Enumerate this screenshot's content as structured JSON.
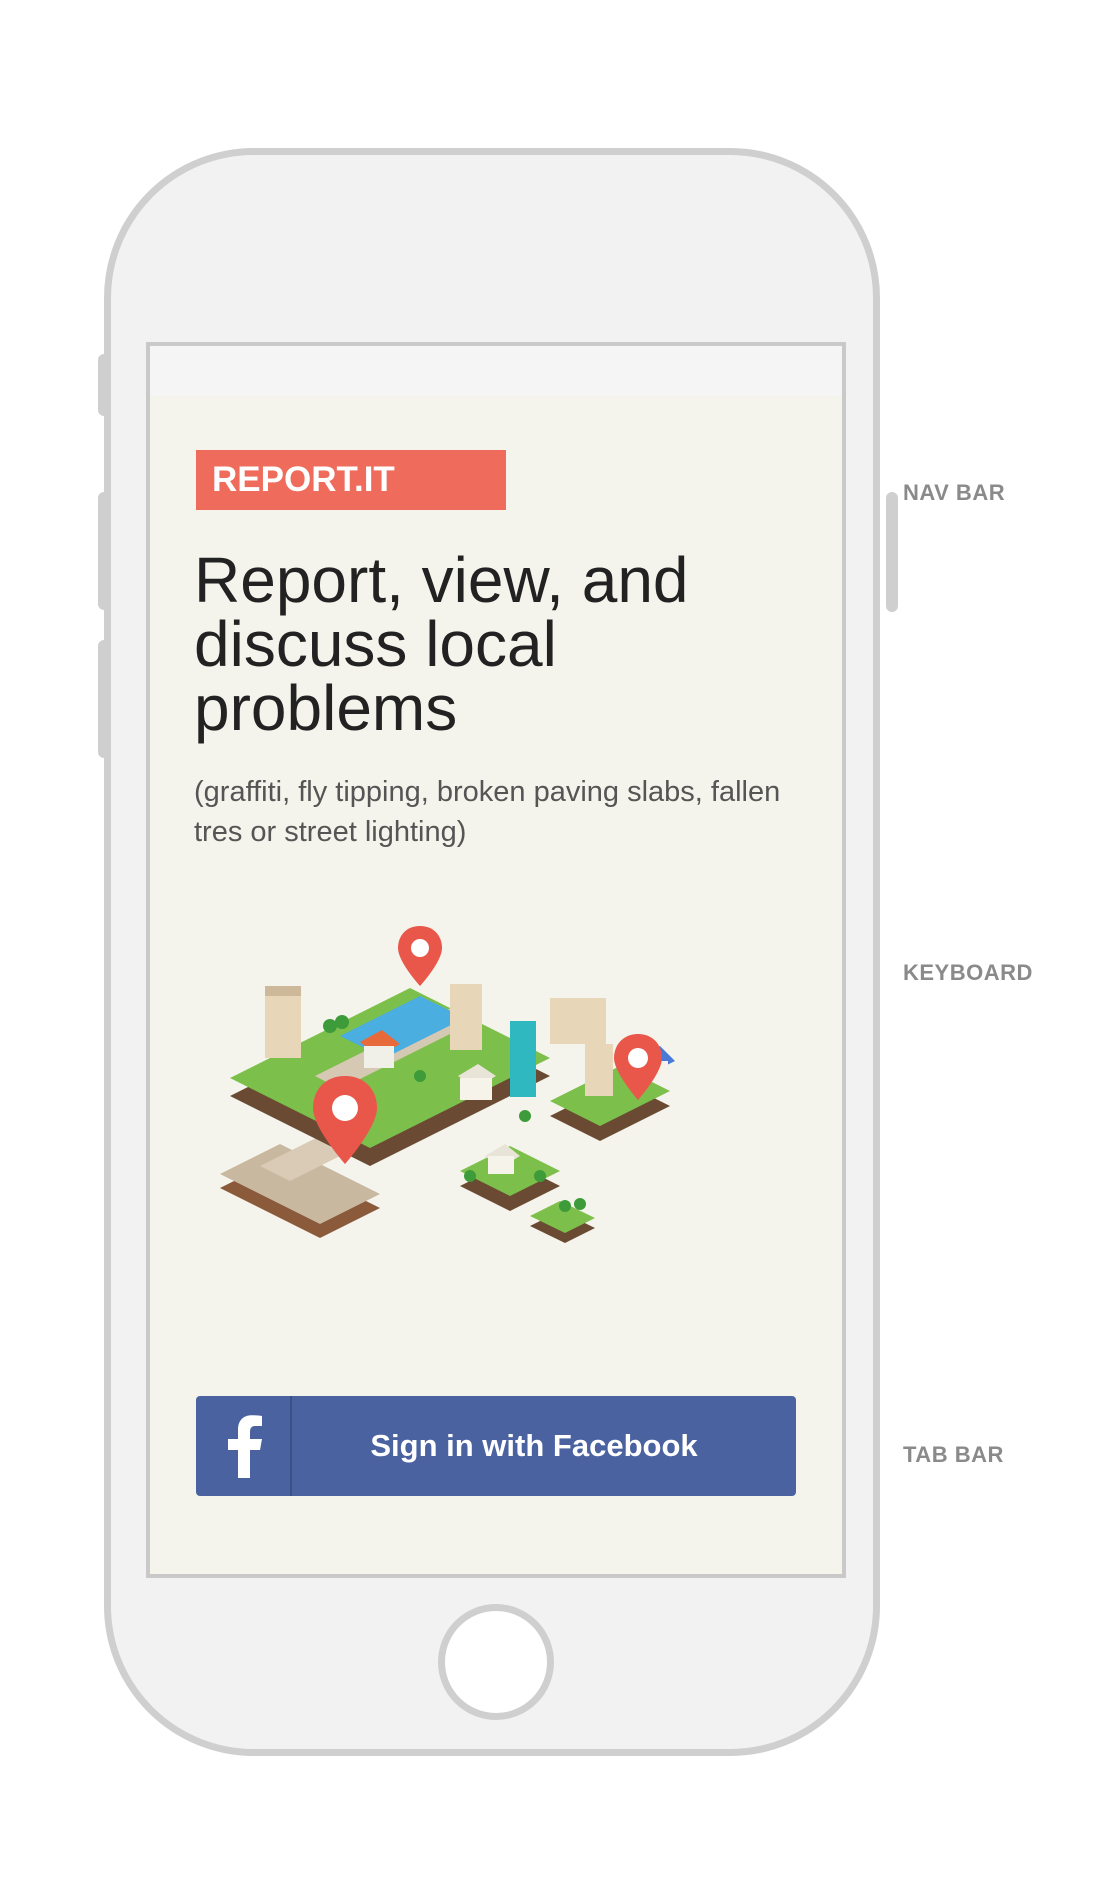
{
  "app": {
    "brand": "REPORT.IT",
    "headline": "Report, view, and discuss local problems",
    "subheadline": "(graffiti, fly tipping, broken paving slabs, fallen tres or street lighting)",
    "facebook_button_label": "Sign in with Facebook",
    "facebook_icon_glyph": "f"
  },
  "annotations": {
    "nav_bar": "NAV BAR",
    "keyboard": "KEYBOARD",
    "tab_bar": "TAB BAR"
  },
  "colors": {
    "brand_red": "#ef6b5b",
    "facebook_blue": "#4a63a0",
    "screen_background": "#f4f4ec",
    "device_frame": "#cfcfcf"
  },
  "icons": {
    "facebook": "facebook-icon",
    "map_pin": "map-pin-icon"
  }
}
